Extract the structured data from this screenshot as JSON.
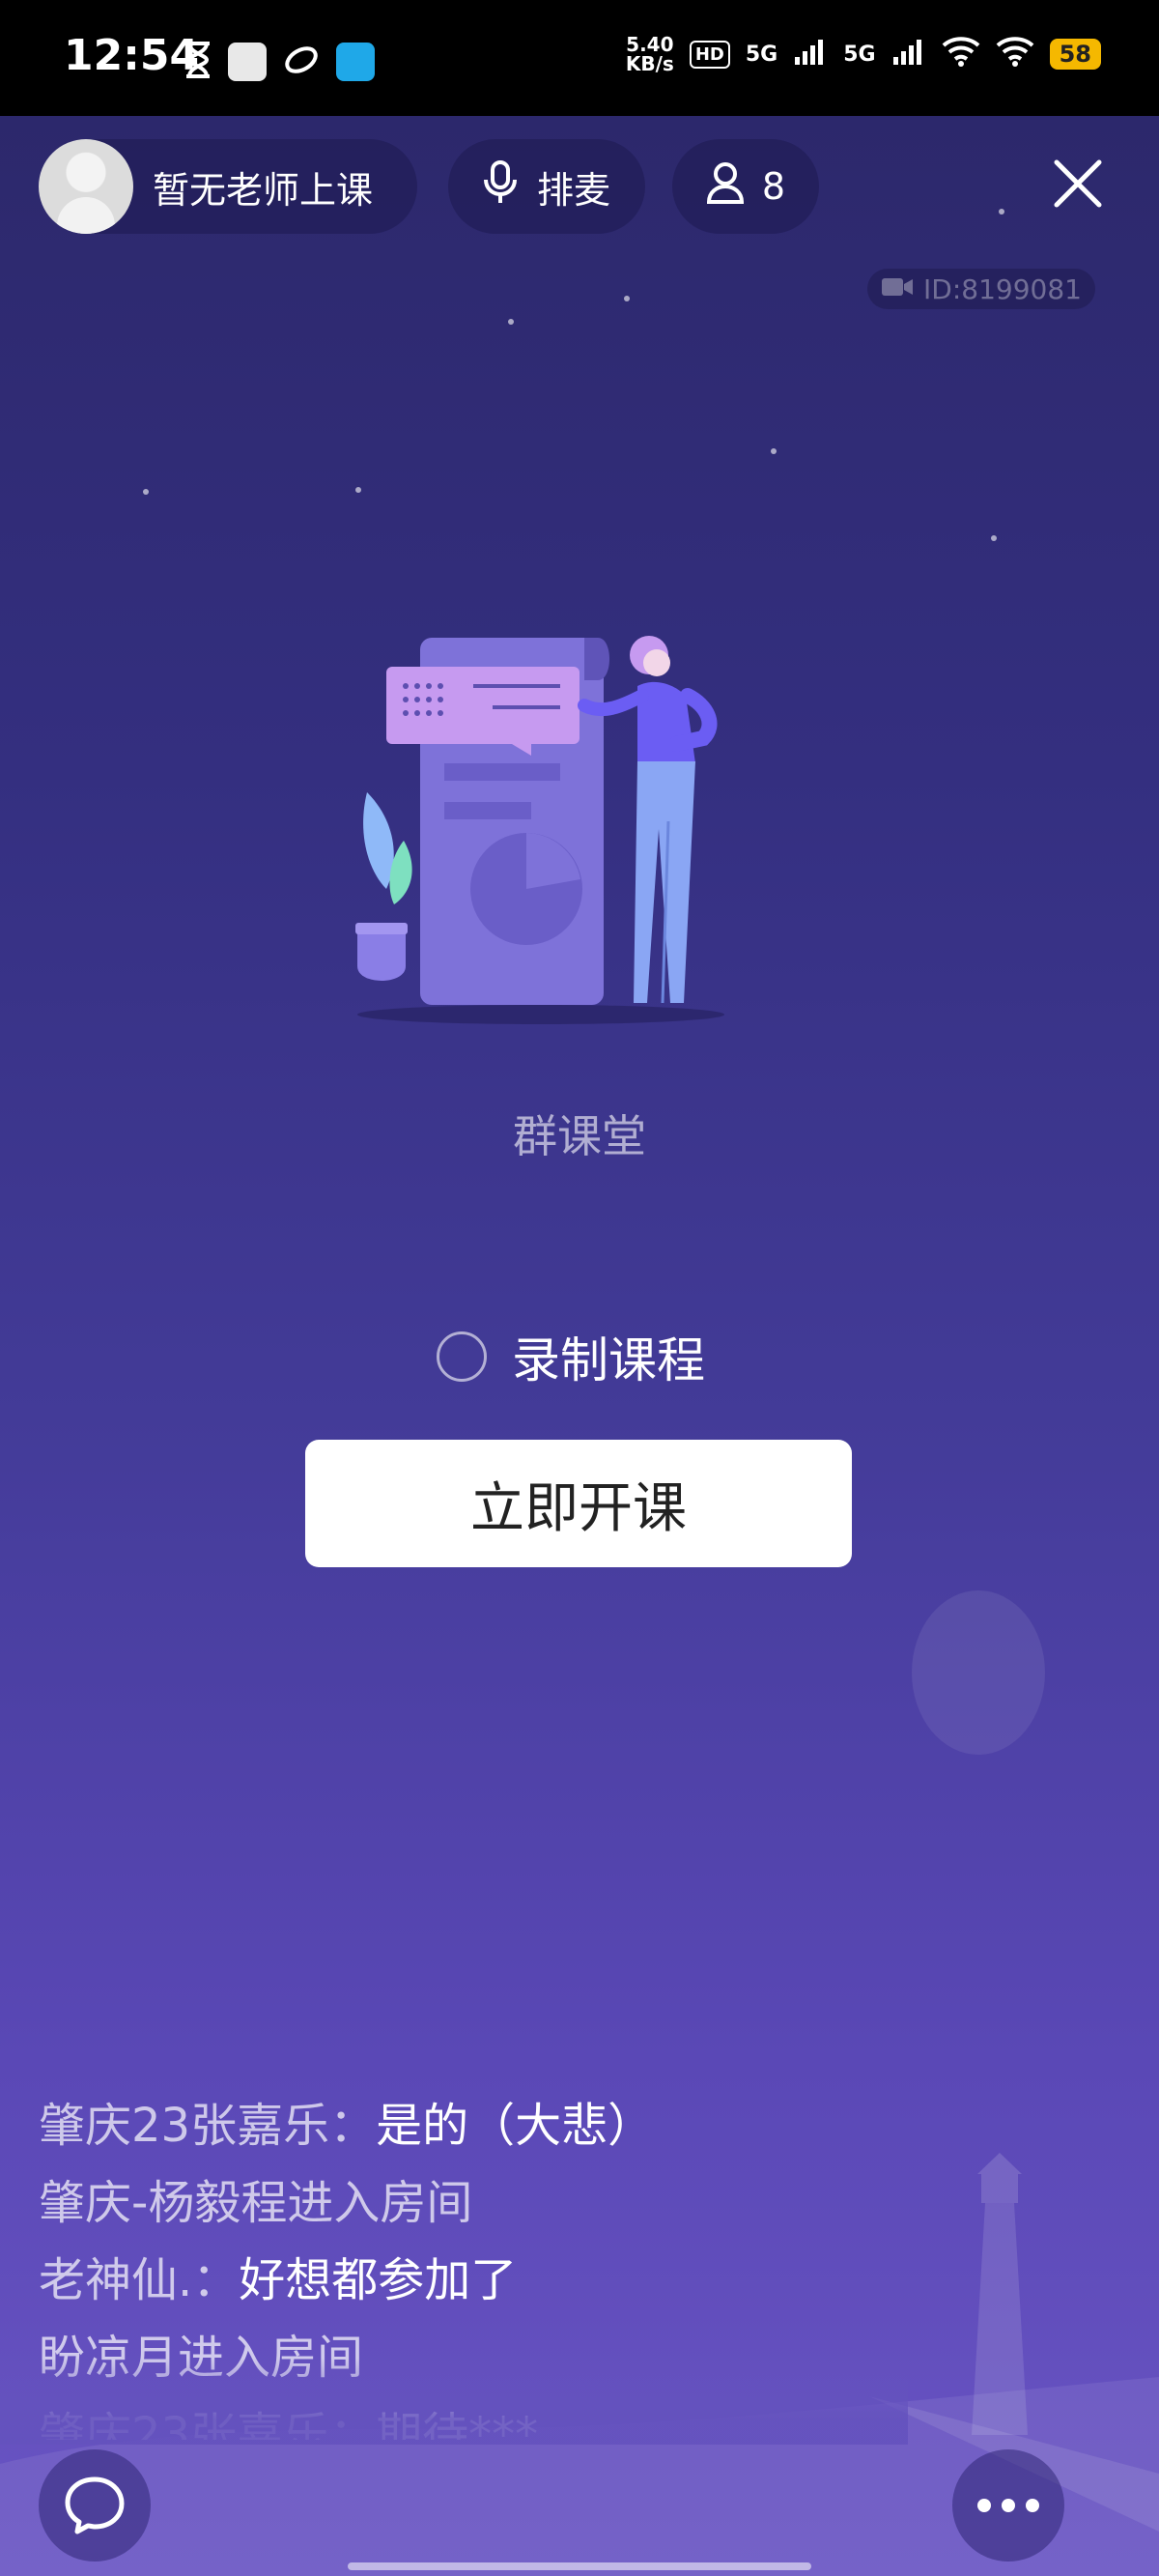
{
  "status_bar": {
    "time": "12:54",
    "net_speed_value": "5.40",
    "net_speed_unit": "KB/s",
    "hd_label": "HD",
    "signal1": "5G",
    "signal2": "5G",
    "battery": "58"
  },
  "header": {
    "teacher_name": "暂无老师上课",
    "mic_queue_label": "排麦",
    "member_count": "8",
    "room_id": "ID:8199081"
  },
  "main": {
    "class_title": "群课堂",
    "record_label": "录制课程",
    "start_button": "立即开课"
  },
  "chat": [
    {
      "name": "肇庆23张嘉乐：",
      "msg": "是的（大悲）"
    },
    {
      "name": "肇庆-杨毅程进入房间",
      "msg": ""
    },
    {
      "name": "老神仙.：",
      "msg": "好想都参加了"
    },
    {
      "name": "盼凉月进入房间",
      "msg": ""
    },
    {
      "name": "肇庆23张嘉乐：",
      "msg": "期待***"
    }
  ],
  "colors": {
    "accent_purple": "#7b6be0",
    "battery": "#f5b800"
  },
  "icons": {
    "mic": "mic-icon",
    "user": "user-icon",
    "close": "close-icon",
    "video": "video-camera-icon",
    "chat": "chat-bubble-icon",
    "more": "more-dots-icon"
  }
}
